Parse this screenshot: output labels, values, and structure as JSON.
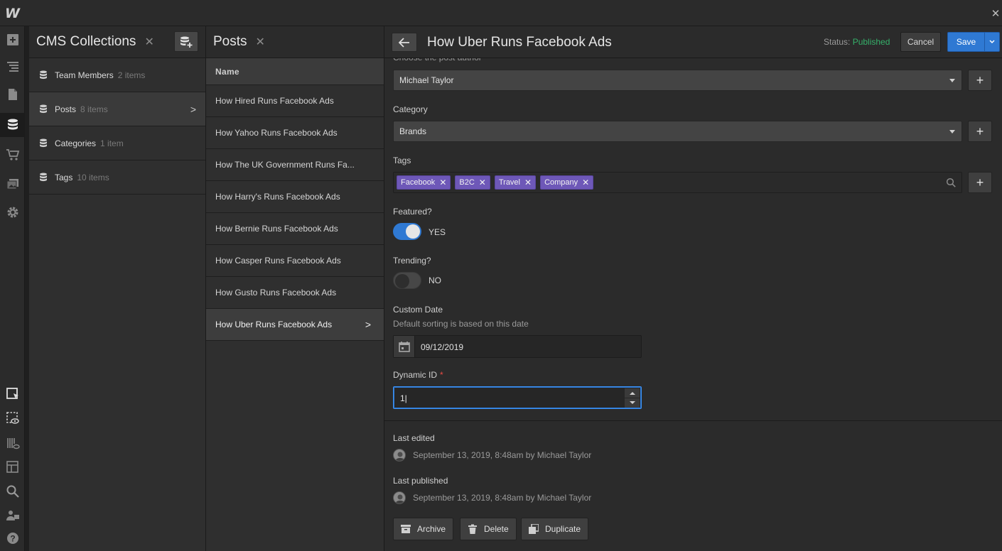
{
  "app": {
    "logo_letter": "W"
  },
  "colors": {
    "accent": "#2f79d3",
    "published": "#35b16a",
    "tag": "#6e58b8",
    "required": "#ea4b43"
  },
  "rail": {
    "icons": [
      "add-icon",
      "navigator-icon",
      "pages-icon",
      "cms-icon",
      "ecommerce-icon",
      "assets-icon",
      "settings-icon",
      "select-icon",
      "preview-icon",
      "audit-icon",
      "layout-preview-icon",
      "search-icon",
      "users-icon",
      "help-icon"
    ]
  },
  "collections": {
    "title": "CMS Collections",
    "items": [
      {
        "name": "Team Members",
        "count": "2 items"
      },
      {
        "name": "Posts",
        "count": "8 items"
      },
      {
        "name": "Categories",
        "count": "1 item"
      },
      {
        "name": "Tags",
        "count": "10 items"
      }
    ]
  },
  "posts": {
    "title": "Posts",
    "column": "Name",
    "rows": [
      "How Hired Runs Facebook Ads",
      "How Yahoo Runs Facebook Ads",
      "How The UK Government Runs Fa...",
      "How Harry's Runs Facebook Ads",
      "How Bernie Runs Facebook Ads",
      "How Casper Runs Facebook Ads",
      "How Gusto Runs Facebook Ads",
      "How Uber Runs Facebook Ads"
    ]
  },
  "editor": {
    "title": "How Uber Runs Facebook Ads",
    "status_label": "Status:",
    "status_value": "Published",
    "cancel": "Cancel",
    "save": "Save",
    "author_label": "Choose the post author",
    "author_value": "Michael Taylor",
    "category_label": "Category",
    "category_value": "Brands",
    "tags_label": "Tags",
    "tags": [
      "Facebook",
      "B2C",
      "Travel",
      "Company"
    ],
    "featured_label": "Featured?",
    "featured_value": "YES",
    "trending_label": "Trending?",
    "trending_value": "NO",
    "date_label": "Custom Date",
    "date_help": "Default sorting is based on this date",
    "date_value": "09/12/2019",
    "dynamic_label": "Dynamic ID",
    "dynamic_required": "*",
    "dynamic_value": "1|",
    "last_edited_label": "Last edited",
    "last_edited_value": "September 13, 2019, 8:48am by Michael Taylor",
    "last_published_label": "Last published",
    "last_published_value": "September 13, 2019, 8:48am by Michael Taylor",
    "archive": "Archive",
    "delete": "Delete",
    "duplicate": "Duplicate"
  }
}
